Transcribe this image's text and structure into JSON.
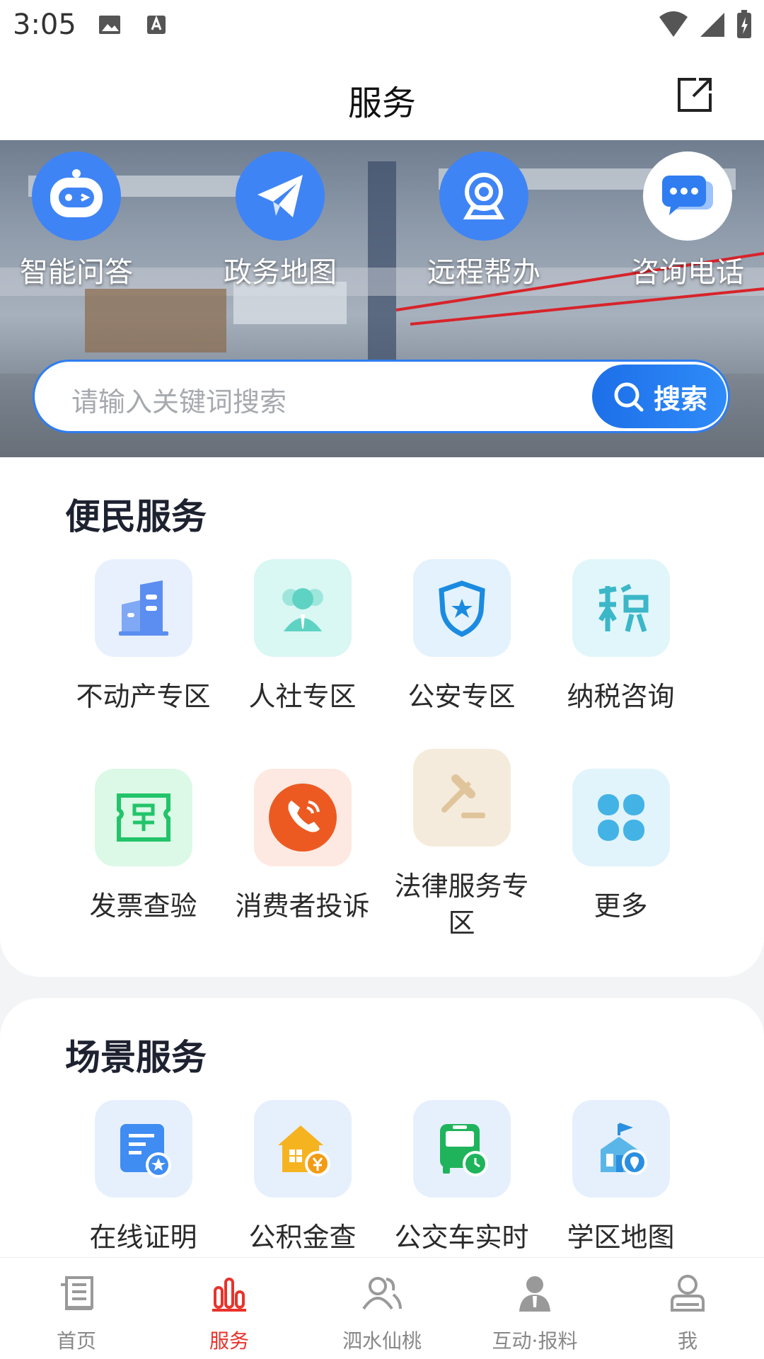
{
  "status_bar": {
    "time": "3:05"
  },
  "header": {
    "title": "服务"
  },
  "quick_actions": [
    {
      "label": "智能问答",
      "icon": "robot-icon"
    },
    {
      "label": "政务地图",
      "icon": "paper-plane-icon"
    },
    {
      "label": "远程帮办",
      "icon": "webcam-icon"
    },
    {
      "label": "咨询电话",
      "icon": "chat-bubble-icon"
    }
  ],
  "search": {
    "placeholder": "请输入关键词搜索",
    "button_label": "搜索"
  },
  "convenience": {
    "title": "便民服务",
    "items": [
      {
        "label": "不动产专区",
        "icon": "building-icon"
      },
      {
        "label": "人社专区",
        "icon": "people-icon"
      },
      {
        "label": "公安专区",
        "icon": "police-shield-icon"
      },
      {
        "label": "纳税咨询",
        "icon": "tax-icon"
      },
      {
        "label": "发票查验",
        "icon": "invoice-icon"
      },
      {
        "label": "消费者投诉",
        "icon": "phone-icon"
      },
      {
        "label": "法律服务专区",
        "icon": "gavel-icon"
      },
      {
        "label": "更多",
        "icon": "grid-icon"
      }
    ]
  },
  "scene": {
    "title": "场景服务",
    "items": [
      {
        "label": "在线证明",
        "icon": "certificate-icon"
      },
      {
        "label": "公积金查",
        "icon": "housing-fund-icon"
      },
      {
        "label": "公交车实时",
        "icon": "bus-icon"
      },
      {
        "label": "学区地图",
        "icon": "school-map-icon"
      }
    ]
  },
  "tabs": [
    {
      "label": "首页",
      "icon": "newspaper-icon",
      "active": false
    },
    {
      "label": "服务",
      "icon": "bars-icon",
      "active": true
    },
    {
      "label": "泗水仙桃",
      "icon": "users-icon",
      "active": false
    },
    {
      "label": "互动·报料",
      "icon": "reporter-icon",
      "active": false
    },
    {
      "label": "我",
      "icon": "profile-icon",
      "active": false
    }
  ],
  "colors": {
    "accent_blue": "#2f7df0",
    "active_tab": "#e8332b"
  }
}
